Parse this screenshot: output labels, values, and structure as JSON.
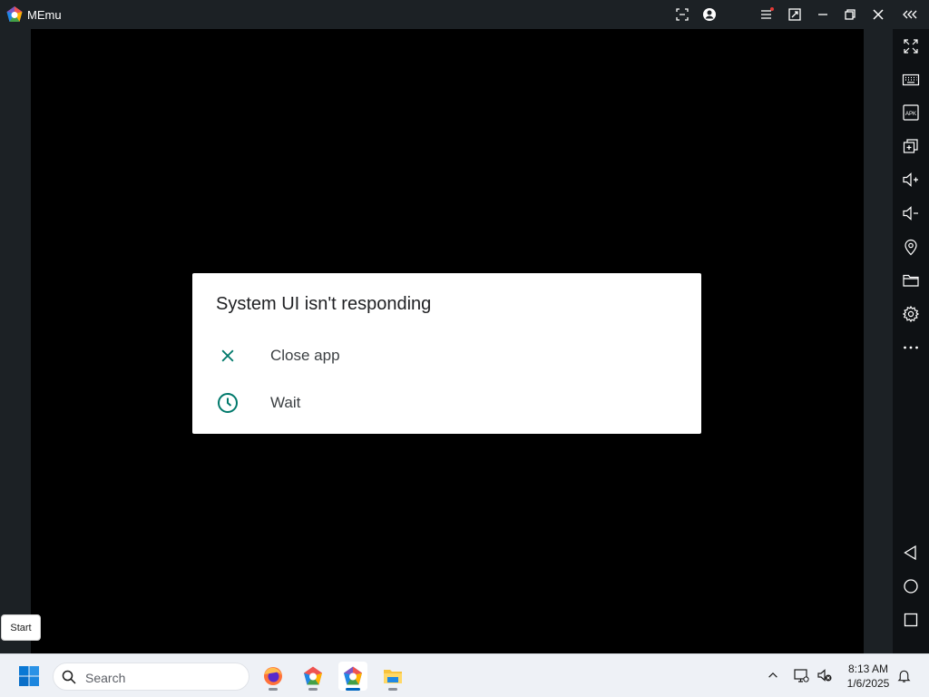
{
  "window": {
    "title": "MEmu"
  },
  "colors": {
    "accent_teal": "#00796b",
    "taskbar_active": "#0067c0",
    "notification_dot": "#e53935"
  },
  "titlebar_buttons": [
    "screenshot-icon",
    "account-icon",
    "menu-icon",
    "multi-window-icon",
    "minimize-icon",
    "restore-icon",
    "close-icon",
    "collapse-sidebar-icon"
  ],
  "sidebar_buttons": [
    "fullscreen-icon",
    "keyboard-icon",
    "apk-icon",
    "add-window-icon",
    "volume-up-icon",
    "volume-down-icon",
    "location-icon",
    "folder-icon",
    "settings-icon",
    "more-icon",
    "back-icon",
    "home-icon",
    "recents-icon"
  ],
  "dialog": {
    "title": "System UI isn't responding",
    "options": [
      {
        "label": "Close app",
        "icon": "close-icon"
      },
      {
        "label": "Wait",
        "icon": "clock-icon"
      }
    ]
  },
  "tooltip": {
    "text": "Start"
  },
  "taskbar": {
    "search_placeholder": "Search",
    "apps": [
      "firefox-icon",
      "memu-multi-icon",
      "memu-icon",
      "file-explorer-icon"
    ],
    "active_app": "memu-icon"
  },
  "tray": {
    "time": "8:13 AM",
    "date": "1/6/2025"
  }
}
